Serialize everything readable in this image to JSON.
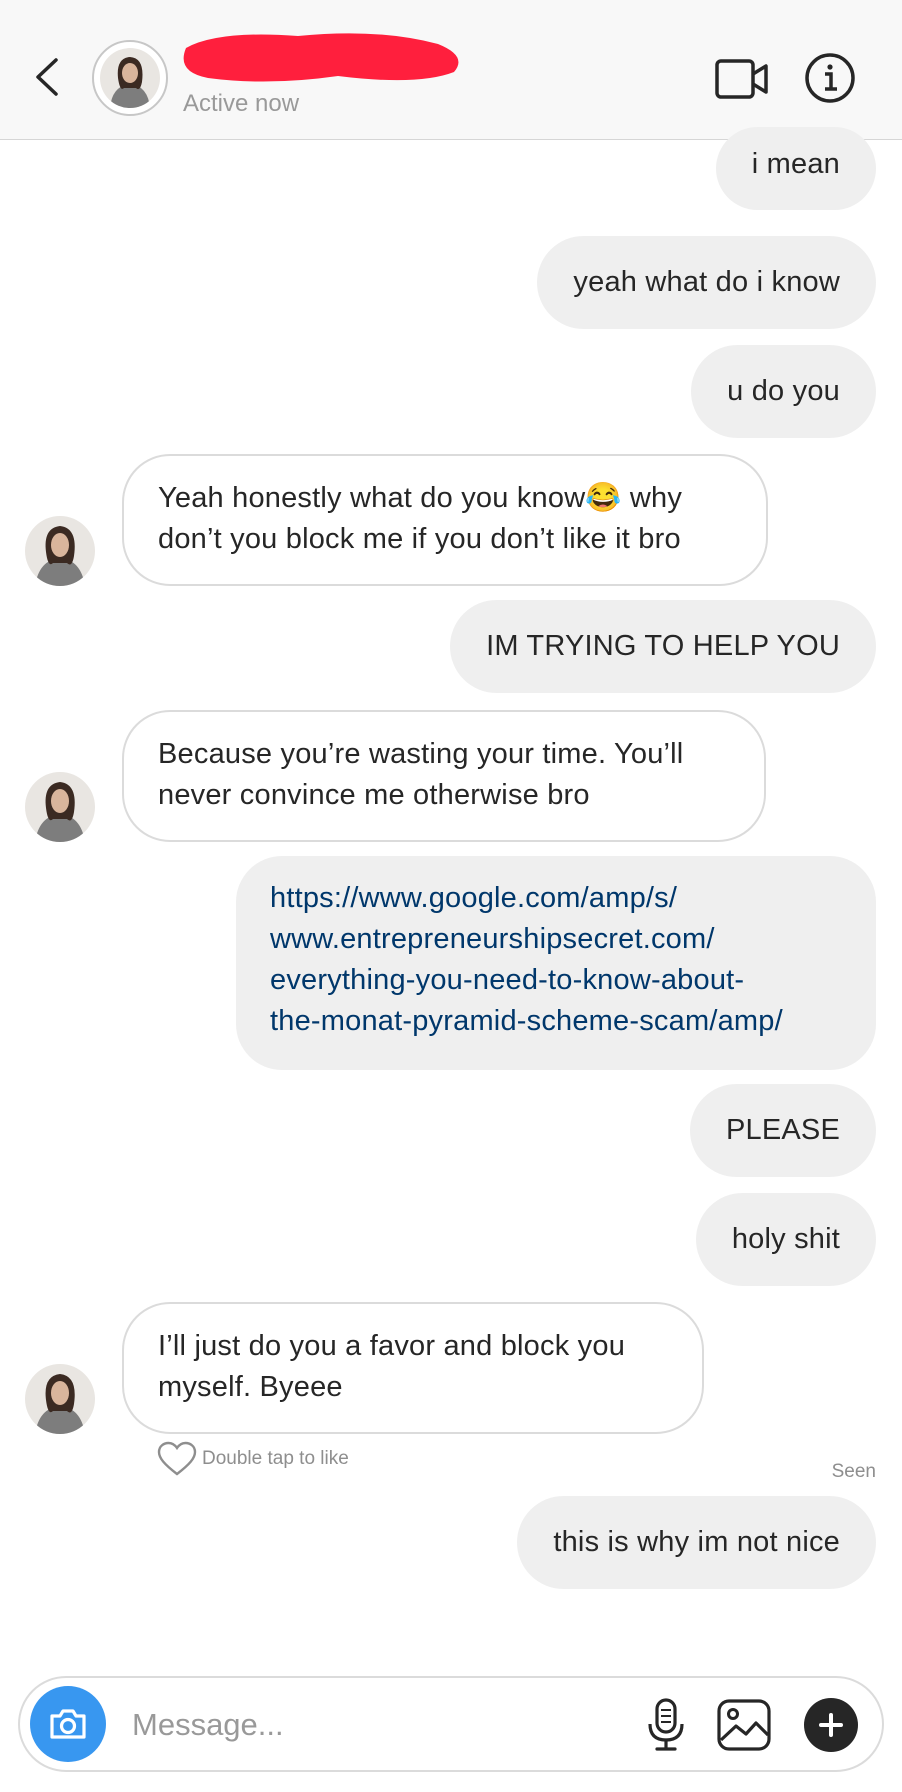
{
  "header": {
    "status": "Active now",
    "redaction_color": "#ff1f3d"
  },
  "messages": [
    {
      "side": "sent",
      "text": "i mean"
    },
    {
      "side": "sent",
      "text": "yeah what do i know"
    },
    {
      "side": "sent",
      "text": "u do you"
    },
    {
      "side": "received",
      "text": "Yeah honestly what do you know😂 why don’t you block me if you don’t like it bro"
    },
    {
      "side": "sent",
      "text": "IM TRYING TO HELP YOU"
    },
    {
      "side": "received",
      "text": "Because you’re wasting your time. You’ll never convince me otherwise bro"
    },
    {
      "side": "sent",
      "text": "https://www.google.com/amp/s/www.entrepreneurshipsecret.com/everything-you-need-to-know-about-the-monat-pyramid-scheme-scam/amp/",
      "lines": [
        "https://www.google.com/amp/s/",
        "www.entrepreneurshipsecret.com/",
        "everything-you-need-to-know-about-",
        "the-monat-pyramid-scheme-scam/amp/"
      ]
    },
    {
      "side": "sent",
      "text": "PLEASE"
    },
    {
      "side": "sent",
      "text": "holy shit"
    },
    {
      "side": "received",
      "text": "I’ll just do you a favor and block you myself. Byeee"
    },
    {
      "side": "sent",
      "text": "this is why im not nice"
    }
  ],
  "like_hint": "Double tap to like",
  "seen_label": "Seen",
  "composer": {
    "placeholder": "Message..."
  },
  "colors": {
    "sent_bubble": "#efefef",
    "received_border": "#dbdbdb",
    "link": "#00376b",
    "camera_button": "#3897f0"
  },
  "icons": [
    "back-chevron-icon",
    "video-camera-icon",
    "info-icon",
    "camera-icon",
    "microphone-icon",
    "gallery-icon",
    "plus-icon",
    "heart-icon"
  ]
}
